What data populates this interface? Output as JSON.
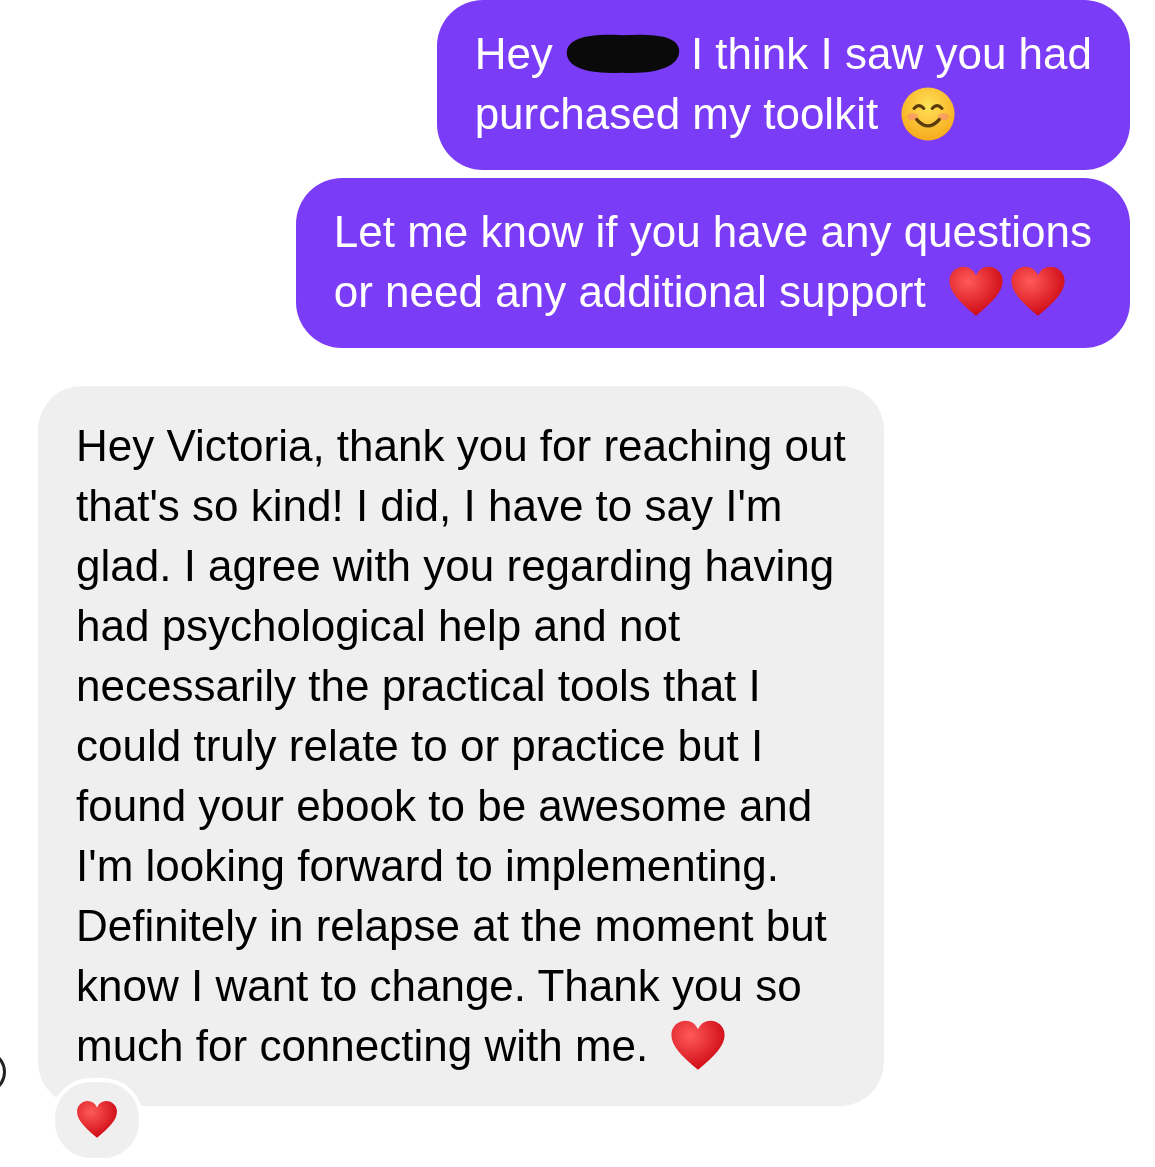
{
  "messages": [
    {
      "kind": "sent",
      "lines": [
        {
          "segments": [
            {
              "kind": "text",
              "text": "Hey"
            },
            {
              "kind": "redaction"
            },
            {
              "kind": "text",
              "text": "I think I saw you had"
            }
          ]
        },
        {
          "segments": [
            {
              "kind": "text",
              "text": "purchased my toolkit"
            },
            {
              "kind": "smiley"
            }
          ]
        }
      ]
    },
    {
      "kind": "sent",
      "lines": [
        {
          "segments": [
            {
              "kind": "text",
              "text": "Let me know if you have any questions"
            }
          ]
        },
        {
          "segments": [
            {
              "kind": "text",
              "text": "or need any additional support"
            },
            {
              "kind": "heart"
            },
            {
              "kind": "heart"
            }
          ]
        }
      ]
    },
    {
      "kind": "received",
      "reaction": {
        "kind": "heart"
      },
      "lines": [
        {
          "segments": [
            {
              "kind": "text",
              "text": "Hey Victoria, thank you for reaching out"
            }
          ]
        },
        {
          "segments": [
            {
              "kind": "text",
              "text": "that's so kind! I did, I have to say I'm"
            }
          ]
        },
        {
          "segments": [
            {
              "kind": "text",
              "text": "glad. I agree with you regarding having"
            }
          ]
        },
        {
          "segments": [
            {
              "kind": "text",
              "text": "had psychological help and not"
            }
          ]
        },
        {
          "segments": [
            {
              "kind": "text",
              "text": "necessarily the practical tools that I"
            }
          ]
        },
        {
          "segments": [
            {
              "kind": "text",
              "text": "could truly relate to or practice but I"
            }
          ]
        },
        {
          "segments": [
            {
              "kind": "text",
              "text": "found your ebook to be awesome and"
            }
          ]
        },
        {
          "segments": [
            {
              "kind": "text",
              "text": "I'm looking forward to implementing."
            }
          ]
        },
        {
          "segments": [
            {
              "kind": "text",
              "text": "Definitely in relapse at the moment but"
            }
          ]
        },
        {
          "segments": [
            {
              "kind": "text",
              "text": "know I want to change. Thank you so"
            }
          ]
        },
        {
          "segments": [
            {
              "kind": "text",
              "text": "much for connecting with me."
            },
            {
              "kind": "heart"
            }
          ]
        }
      ]
    }
  ]
}
